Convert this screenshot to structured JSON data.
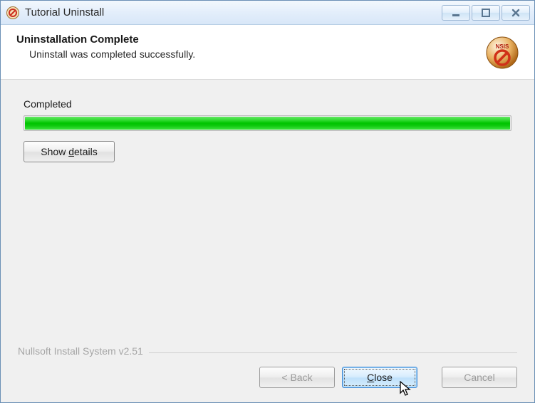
{
  "window": {
    "title": "Tutorial Uninstall"
  },
  "header": {
    "title": "Uninstallation Complete",
    "subtitle": "Uninstall was completed successfully."
  },
  "body": {
    "status": "Completed",
    "progress_percent": 100,
    "show_details_prefix": "Show ",
    "show_details_key": "d",
    "show_details_suffix": "etails"
  },
  "footer": {
    "branding": "Nullsoft Install System v2.51",
    "back_label": "< Back",
    "close_prefix": "",
    "close_key": "C",
    "close_suffix": "lose",
    "cancel_label": "Cancel"
  }
}
